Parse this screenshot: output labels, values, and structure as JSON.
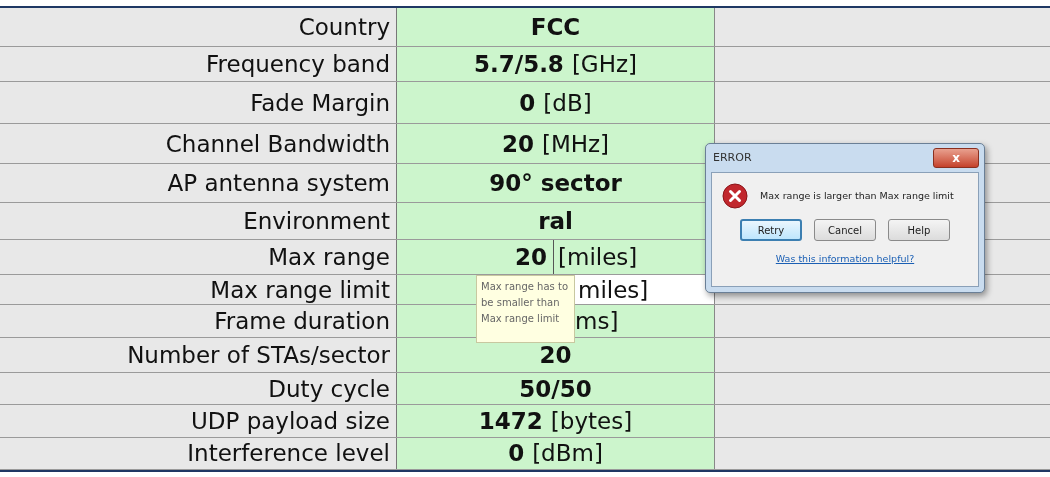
{
  "rows": [
    {
      "label": "Country",
      "value": "FCC",
      "kind": "inline"
    },
    {
      "label": "Frequency band",
      "value": "5.7/5.8",
      "unit": "[GHz]",
      "kind": "inline"
    },
    {
      "label": "Fade Margin",
      "value": "0",
      "unit": "[dB]",
      "kind": "inline"
    },
    {
      "label": "Channel Bandwidth",
      "value": "20",
      "unit": "[MHz]",
      "kind": "inline"
    },
    {
      "label": "AP antenna system",
      "value": "90° sector",
      "kind": "inline"
    },
    {
      "label": "Environment",
      "value": "ral",
      "kind": "inline"
    },
    {
      "label": "Max range",
      "value": "20",
      "unit": "[miles]",
      "kind": "bordered"
    },
    {
      "label": "Max range limit",
      "unit": "miles]",
      "kind": "white"
    },
    {
      "label": "Frame duration",
      "unit": "ms]",
      "kind": "plain"
    },
    {
      "label": "Number of STAs/sector",
      "value": "20",
      "kind": "inline"
    },
    {
      "label": "Duty cycle",
      "value": "50/50",
      "kind": "inline"
    },
    {
      "label": "UDP payload size",
      "value": "1472",
      "unit": "[bytes]",
      "kind": "inline"
    },
    {
      "label": "Interference level",
      "value": "0",
      "unit": "[dBm]",
      "kind": "inline"
    }
  ],
  "tooltip": "Max range has to be smaller than Max range limit",
  "dialog": {
    "title": "ERROR",
    "close": "x",
    "message": "Max range is larger than Max range limit",
    "buttons": [
      {
        "label": "Retry",
        "selected": true
      },
      {
        "label": "Cancel",
        "selected": false
      },
      {
        "label": "Help",
        "selected": false
      }
    ],
    "link": "Was this information helpful?"
  }
}
